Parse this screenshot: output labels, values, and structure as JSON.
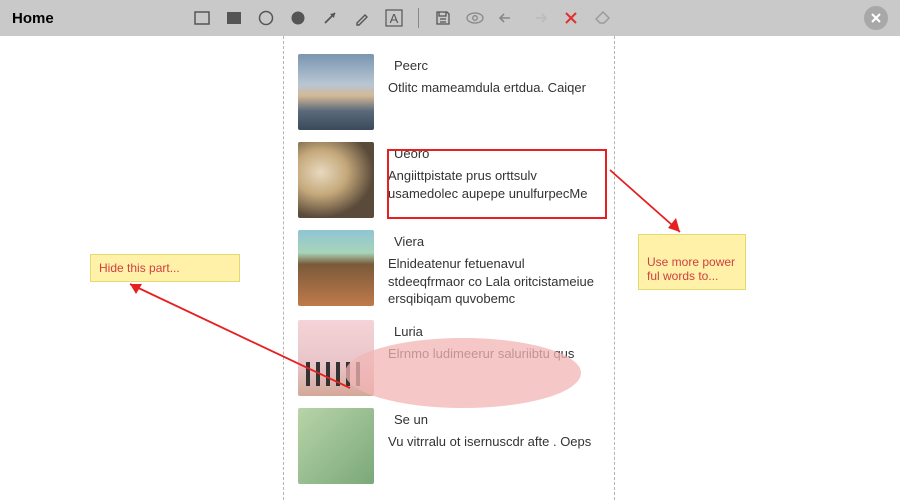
{
  "toolbar": {
    "title": "Home",
    "tools": {
      "rect_outline": "rectangle-outline",
      "rect_filled": "rectangle-filled",
      "circle_outline": "circle-outline",
      "circle_filled": "circle-filled",
      "arrow": "arrow",
      "pencil": "pencil",
      "text": "text",
      "save": "save",
      "preview": "preview",
      "undo": "undo",
      "redo": "redo",
      "delete": "delete",
      "clear": "clear"
    }
  },
  "entries": [
    {
      "title": "Peerc",
      "body": "Otlitc mameamdula ertdua. Caiqer"
    },
    {
      "title": "Ueoro",
      "body": "Angiittpistate prus orttsulv usamedolec aupepe unulfurpecMe"
    },
    {
      "title": "Viera",
      "body": "Elnideatenur fetuenavul stdeeqfrmaor co    Lala oritcistameiue ersqibiqam quvobemc"
    },
    {
      "title": "Luria",
      "body": "Elrnmo ludimeerur saluriibtu qus"
    },
    {
      "title": "Se un",
      "body": "Vu vitrralu ot isernuscdr afte . Oeps"
    }
  ],
  "annotations": {
    "note_left": "Hide this part...",
    "note_right": "Use more power\nful words to...",
    "redbox_target": "entry-ueoro",
    "ellipse_target": "entry-luria"
  },
  "colors": {
    "annotation_red": "#e62020",
    "note_bg": "#fff1a8",
    "ellipse_fill": "rgba(242,180,180,0.75)"
  }
}
